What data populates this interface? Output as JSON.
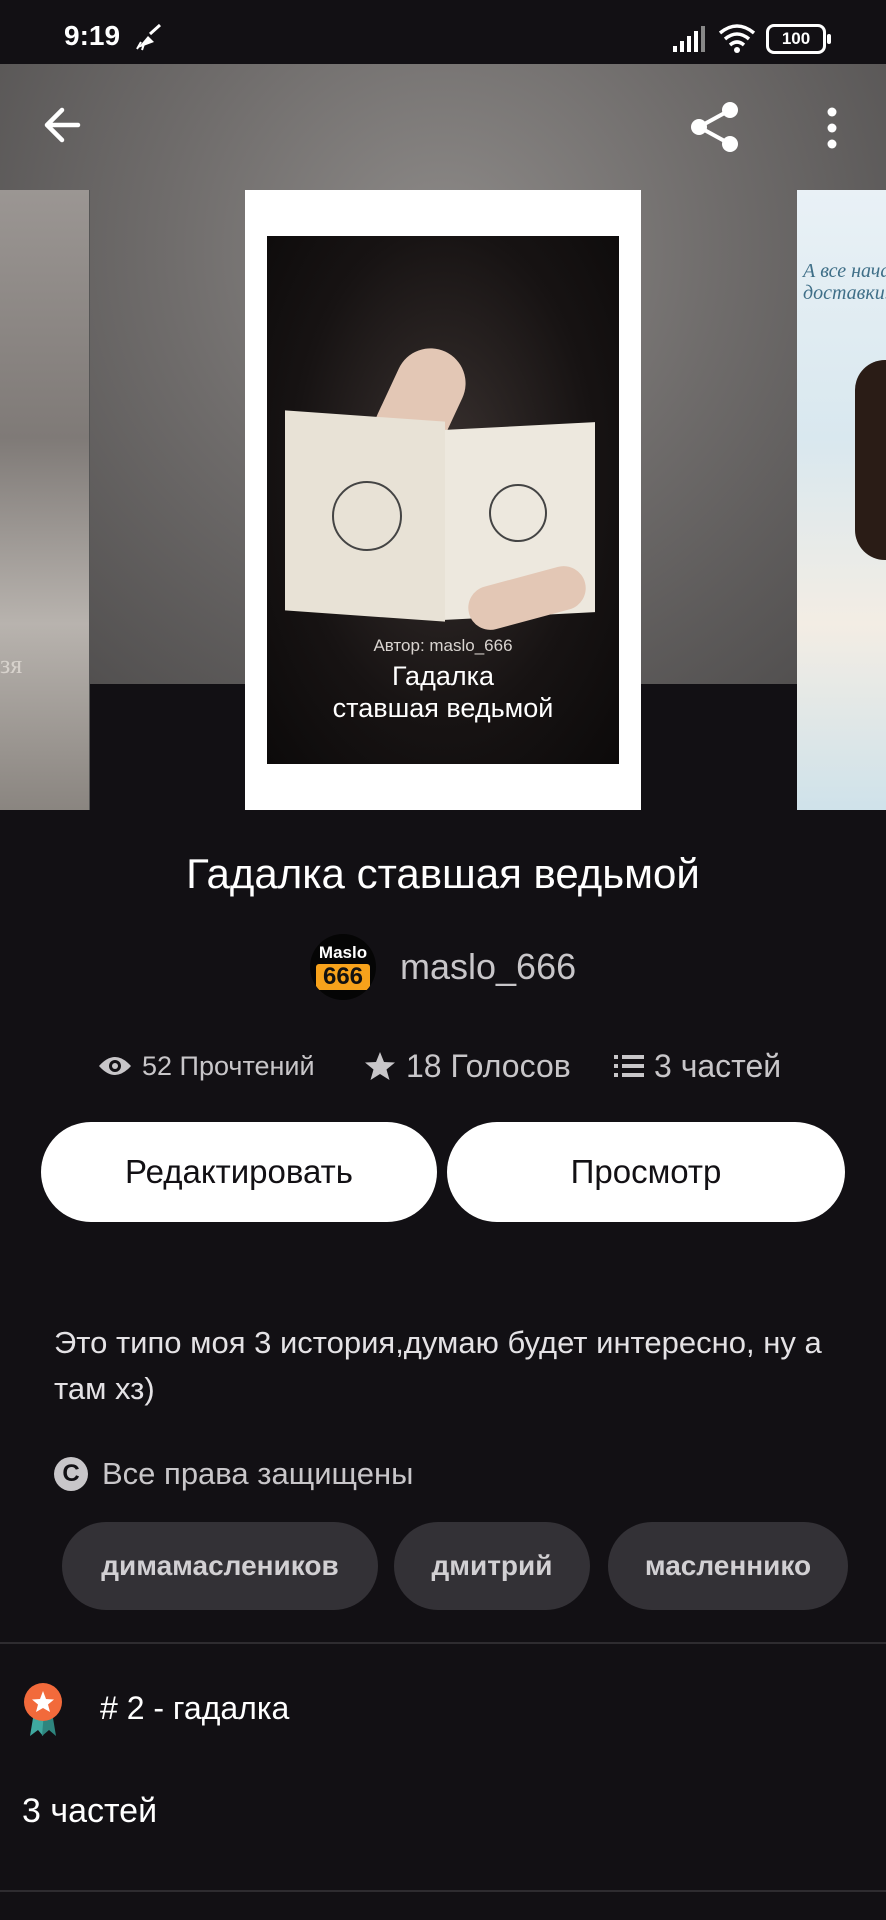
{
  "status_bar": {
    "time": "9:19",
    "battery": "100"
  },
  "cover": {
    "author_line": "Автор: maslo_666",
    "title_line1": "Гадалка",
    "title_line2": "ставшая ведьмой"
  },
  "side_covers": {
    "left_fragment": "зя",
    "right_fragment_1": "А все нача",
    "right_fragment_2": "доставки..."
  },
  "story": {
    "title": "Гадалка ставшая ведьмой",
    "author": "maslo_666",
    "avatar_top": "Maslo",
    "avatar_num": "666",
    "reads": "52 Прочтений",
    "votes": "18 Голосов",
    "parts": "3 частей",
    "description": "Это типо моя 3 история,думаю будет интересно, ну а там хз)",
    "copyright": "Все права защищены"
  },
  "actions": {
    "edit_label": "Редактировать",
    "preview_label": "Просмотр"
  },
  "tags": [
    "димамаслеников",
    "дмитрий",
    "масленнико"
  ],
  "ranking": {
    "text": "# 2 - гадалка"
  },
  "parts_section": {
    "heading": "3 частей"
  },
  "colors": {
    "background": "#121014",
    "tag_bg": "#333136",
    "secondary_text": "#c8c6c9",
    "badge_orange": "#f26a3b",
    "badge_teal": "#3fa9a0"
  }
}
